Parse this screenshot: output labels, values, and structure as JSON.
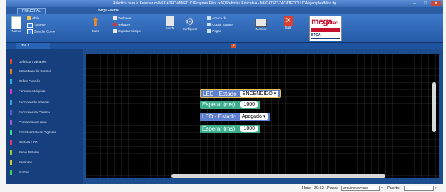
{
  "window": {
    "title": "Robotica para la Ensenanza MEGATEC-MINED C:/Program Files (x86)/Robotica Educativa - MEGATEC-ZACATECOLUCA/ejemplos/blink.ttg",
    "minimize": "–",
    "maximize": "□",
    "close": "✕"
  },
  "ribbon_tabs": [
    "PRINCIPAL",
    "Código Fuente"
  ],
  "ribbon": {
    "nuevo": "Nuevo",
    "abrir": "Abrir",
    "guardar": "Guardar",
    "guardar_como": "Guardar Como",
    "subir": "Subir",
    "deshacer": "Deshacer",
    "rehacer": "Rehacer",
    "exportar": "Exportar código",
    "ayuda": "Ayuda",
    "configurar": "Configurar",
    "acerca": "Acerca de",
    "copiar": "Copiar Bloque",
    "pegar": "Pegar",
    "monitor": "Monitor",
    "salir": "Salir"
  },
  "logo": {
    "brand": "mega",
    "suffix": "tec",
    "sub": "ETCA"
  },
  "doc_tab": "Tab 1",
  "sidebar": {
    "items": [
      {
        "label": "Definicion Variables",
        "color": "#e0442b"
      },
      {
        "label": "Estructuras de Control",
        "color": "#e07a2b"
      },
      {
        "label": "Definir Función",
        "color": "#2bb0e0"
      },
      {
        "label": "Funciones Lógicas",
        "color": "#d43ad4"
      },
      {
        "label": "Funciones Numéricas",
        "color": "#3aa0d4"
      },
      {
        "label": "Funciones de Cadena",
        "color": "#5a5ae0"
      },
      {
        "label": "Comunicacion serie",
        "color": "#a05ae0"
      },
      {
        "label": "Entradas/Salidas Digitales",
        "color": "#3ad48c"
      },
      {
        "label": "Pantalla LCD",
        "color": "#e03a7a"
      },
      {
        "label": "Servo Motores",
        "color": "#8ad43a"
      },
      {
        "label": "Sensores",
        "color": "#d4c43a"
      },
      {
        "label": "Buzzer",
        "color": "#3ad45a"
      }
    ]
  },
  "blocks": [
    {
      "label": "LED - Estado",
      "value": "ENCENDIDO",
      "arrow": "▾"
    },
    {
      "label": "Esperar (ms)",
      "value": "1000"
    },
    {
      "label": "LED - Estado",
      "value": "Apagado",
      "arrow": "▾"
    },
    {
      "label": "Esperar (ms)",
      "value": "1000"
    }
  ],
  "status": {
    "hora_label": "Hora:",
    "hora": "20:52",
    "placa_label": "Placa:",
    "placa": "arduino:avr:uno",
    "puerto_label": "Puerto:",
    "puerto": ""
  }
}
